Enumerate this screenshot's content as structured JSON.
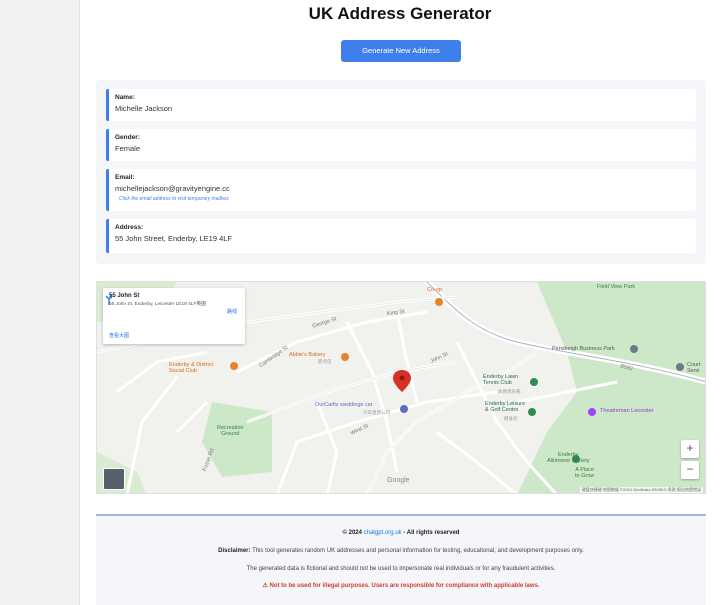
{
  "page": {
    "title": "UK Address Generator"
  },
  "actions": {
    "generate_label": "Generate New Address"
  },
  "cards": {
    "name": {
      "label": "Name:",
      "value": "Michelle Jackson"
    },
    "gender": {
      "label": "Gender:",
      "value": "Female"
    },
    "email": {
      "label": "Email:",
      "value": "michellejackson@gravityengine.cc",
      "note": "Click the email address to visit temporary mailbox"
    },
    "address": {
      "label": "Address:",
      "value": "55 John Street, Enderby, LE19 4LF"
    }
  },
  "map": {
    "info": {
      "title": "55 John St",
      "subtitle": "55 John St, Enderby, Leicester LE19 4LF英国",
      "directions_label": "路线",
      "larger_map": "查看大图"
    },
    "zoom_in": "+",
    "zoom_out": "−",
    "google": "Google",
    "attribution": "键盘快捷键  地图数据 ©2024 GeoBasis-DE/BKG  条款  报告地图错误",
    "labels": {
      "field_view_park": "Field View Park",
      "pensbeigh": "Pensbeigh Business Park",
      "enderby_social": "Enderby & District\nSocial Club",
      "bakery": "Abbie's Bakery",
      "bakery_cn": "糕点店",
      "enderby_lawn": "Enderby Lawn\nTennis Club",
      "enderby_lawn_cn": "体育俱乐部",
      "ourcarfix": "OurCarfix weddings car",
      "ourcarfix_cn": "汽车租赁公司",
      "enderby_leisure": "Enderby Leisure\n& Golf Centre",
      "enderby_leisure_cn": "健身房",
      "theatre": "Theatreman Leicester",
      "recreation": "Recreation\nGround",
      "allotment": "Enderby\nAllotment Society",
      "a_place": "A Place\nto Grow",
      "court": "Court\nServi",
      "george_st": "George St",
      "king_st": "King St",
      "cambridge_st": "Cambridge St",
      "fosse_rd": "Fosse Rd",
      "john_st": "John St",
      "west_st": "West St",
      "b582": "B582",
      "co_op": "Co-op"
    }
  },
  "footer": {
    "copyright_prefix": "© 2024",
    "site": "chatgpt.org.uk",
    "copyright_suffix": "- All rights reserved",
    "disclaimer_label": "Disclaimer:",
    "disclaimer_text": "This tool generates random UK addresses and personal information for testing, educational, and development purposes only.",
    "fictional": "The generated data is fictional and should not be used to impersonate real individuals or for any fraudulent activities.",
    "warning": "⚠ Not to be used for illegal purposes. Users are responsible for compliance with applicable laws."
  },
  "colors": {
    "accent": "#3f7fec",
    "pin": "#d93025",
    "park": "#cde8c8",
    "warning": "#d23c2c"
  }
}
